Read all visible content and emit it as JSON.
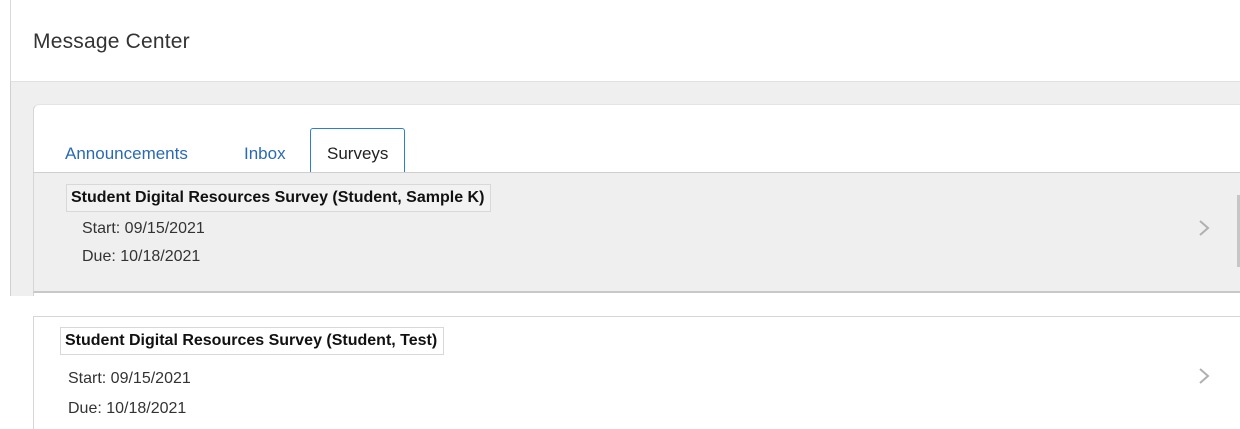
{
  "header": {
    "title": "Message Center"
  },
  "tabs": [
    {
      "label": "Announcements",
      "active": false
    },
    {
      "label": "Inbox",
      "active": false
    },
    {
      "label": "Surveys",
      "active": true
    }
  ],
  "surveys": [
    {
      "title": "Student Digital Resources Survey (Student, Sample K)",
      "start": "Start: 09/15/2021",
      "due": "Due: 10/18/2021",
      "icon": "chevron-right-icon"
    },
    {
      "title": "Student Digital Resources Survey (Student, Test)",
      "start": "Start: 09/15/2021",
      "due": "Due: 10/18/2021",
      "icon": "chevron-right-icon"
    }
  ],
  "colors": {
    "tab_link": "#2a6ab3",
    "active_tab_border": "#2a7fd1",
    "band_background": "#efefef"
  }
}
